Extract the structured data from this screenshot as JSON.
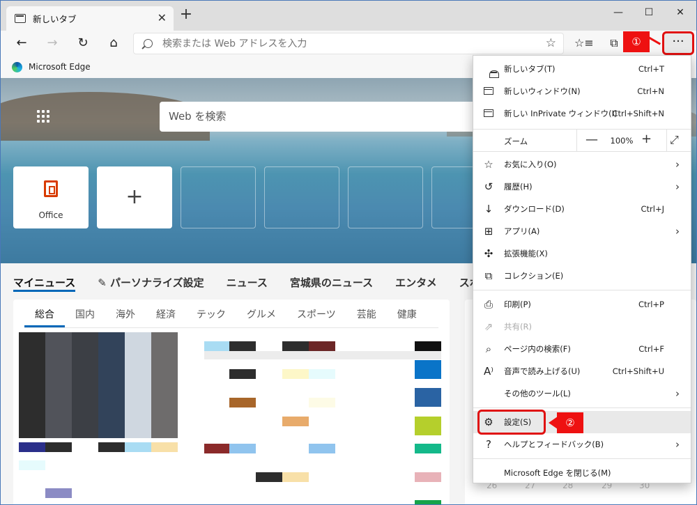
{
  "tab": {
    "title": "新しいタブ",
    "close": "✕",
    "new": "+"
  },
  "window": {
    "minimize": "—",
    "maximize": "☐",
    "close": "✕"
  },
  "toolbar": {
    "back": "←",
    "forward": "→",
    "refresh": "↻",
    "home": "⌂",
    "favorite_star": "☆",
    "favorites_list": "☆≡",
    "collections": "⧉",
    "more": "···"
  },
  "address": {
    "placeholder": "検索または Web アドレスを入力"
  },
  "favorites_bar": {
    "item": "Microsoft Edge"
  },
  "newtab": {
    "search_placeholder": "Web を検索",
    "tiles": [
      {
        "label": "Office"
      },
      {
        "label": "+"
      }
    ],
    "news_nav": [
      "マイニュース",
      "✎ パーソナライズ設定",
      "ニュース",
      "宮城県のニュース",
      "エンタメ",
      "スポーツ"
    ],
    "categories": [
      "総合",
      "国内",
      "海外",
      "経済",
      "テック",
      "グルメ",
      "スポーツ",
      "芸能",
      "健康"
    ],
    "calendar": [
      "26",
      "27",
      "28",
      "29",
      "30"
    ]
  },
  "annotations": {
    "one": "①",
    "two": "②"
  },
  "menu": {
    "new_tab": {
      "label": "新しいタブ(T)",
      "shortcut": "Ctrl+T"
    },
    "new_window": {
      "label": "新しいウィンドウ(N)",
      "shortcut": "Ctrl+N"
    },
    "new_inprivate": {
      "label": "新しい InPrivate ウィンドウ(I)",
      "shortcut": "Ctrl+Shift+N"
    },
    "zoom": {
      "label": "ズーム",
      "minus": "—",
      "value": "100%",
      "plus": "+",
      "fullscreen": "⤢"
    },
    "favorites": {
      "label": "お気に入り(O)"
    },
    "history": {
      "label": "履歴(H)"
    },
    "downloads": {
      "label": "ダウンロード(D)",
      "shortcut": "Ctrl+J"
    },
    "apps": {
      "label": "アプリ(A)"
    },
    "extensions": {
      "label": "拡張機能(X)"
    },
    "collections": {
      "label": "コレクション(E)"
    },
    "print": {
      "label": "印刷(P)",
      "shortcut": "Ctrl+P"
    },
    "share": {
      "label": "共有(R)"
    },
    "find": {
      "label": "ページ内の検索(F)",
      "shortcut": "Ctrl+F"
    },
    "read_aloud": {
      "label": "音声で読み上げる(U)",
      "shortcut": "Ctrl+Shift+U"
    },
    "more_tools": {
      "label": "その他のツール(L)"
    },
    "settings": {
      "label": "設定(S)"
    },
    "help": {
      "label": "ヘルプとフィードバック(B)"
    },
    "close_edge": {
      "label": "Microsoft Edge を閉じる(M)"
    },
    "chevron": "›"
  },
  "colors": {
    "accent": "#0067b8",
    "annotation_red": "#ee1111"
  }
}
